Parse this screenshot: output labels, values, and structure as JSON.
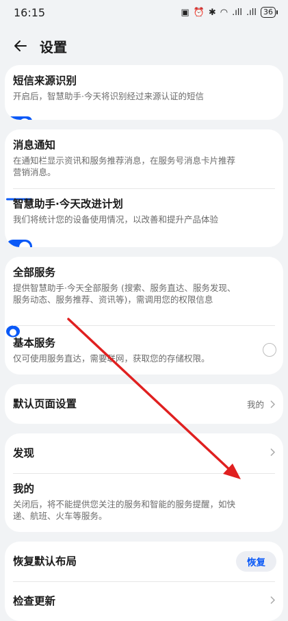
{
  "status_bar": {
    "time": "16:15",
    "icons": [
      "nfc-icon",
      "alarm-icon",
      "bluetooth-icon",
      "wifi-icon",
      "signal-icon",
      "signal-icon"
    ],
    "battery": "36"
  },
  "header": {
    "title": "设置"
  },
  "cards": {
    "sms": {
      "title": "短信来源识别",
      "desc": "开启后，智慧助手·今天将识别经过来源认证的短信",
      "enabled": true
    },
    "notify": {
      "title": "消息通知",
      "desc": "在通知栏显示资讯和服务推荐消息，在服务号消息卡片推荐营销消息。",
      "enabled": true
    },
    "improve": {
      "title": "智慧助手·今天改进计划",
      "desc": "我们将统计您的设备使用情况，以改善和提升产品体验",
      "enabled": true
    },
    "all_services": {
      "title": "全部服务",
      "desc": "提供智慧助手·今天全部服务 (搜索、服务直达、服务发现、服务动态、服务推荐、资讯等)，需调用您的权限信息",
      "selected": true
    },
    "basic_services": {
      "title": "基本服务",
      "desc": "仅可使用服务直达，需要联网，获取您的存储权限。",
      "selected": false
    },
    "default_page": {
      "title": "默认页面设置",
      "value": "我的"
    },
    "discover": {
      "title": "发现"
    },
    "mine": {
      "title": "我的",
      "desc": "关闭后，将不能提供您关注的服务和智能的服务提醒，如快递、航班、火车等服务。",
      "enabled": true
    },
    "restore_layout": {
      "title": "恢复默认布局",
      "button": "恢复"
    },
    "check_update": {
      "title": "检查更新"
    }
  },
  "colors": {
    "accent": "#0a59f7",
    "annotation": "#e02020",
    "background": "#f1f3f5"
  }
}
